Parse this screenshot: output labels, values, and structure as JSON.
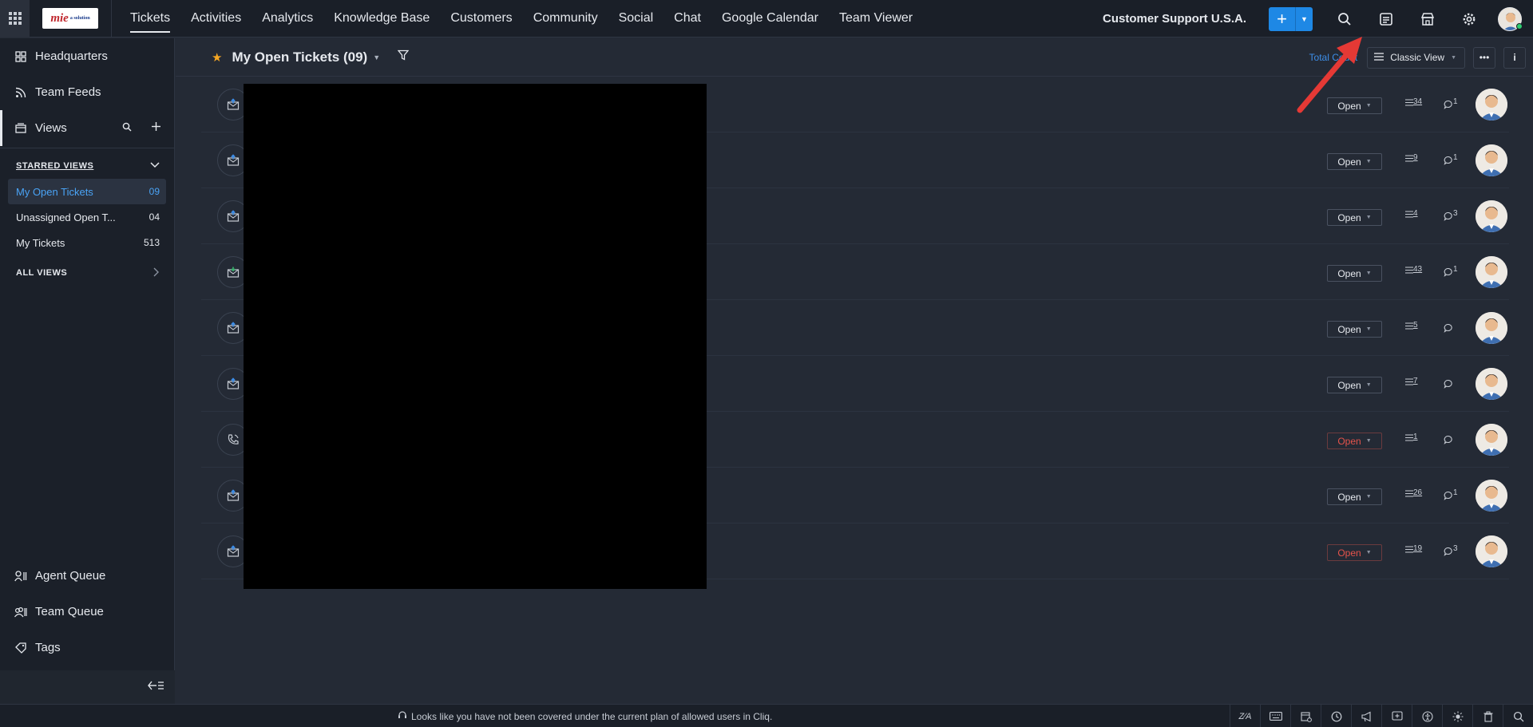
{
  "topbar": {
    "logo_text": "mie",
    "logo_sub": "a solution",
    "nav": [
      {
        "label": "Tickets",
        "active": true
      },
      {
        "label": "Activities"
      },
      {
        "label": "Analytics"
      },
      {
        "label": "Knowledge Base"
      },
      {
        "label": "Customers"
      },
      {
        "label": "Community"
      },
      {
        "label": "Social"
      },
      {
        "label": "Chat"
      },
      {
        "label": "Google Calendar"
      },
      {
        "label": "Team Viewer"
      }
    ],
    "org_name": "Customer Support U.S.A.",
    "add_label": "+",
    "icons": [
      "search-icon",
      "compose-ticket-icon",
      "marketplace-icon",
      "settings-icon"
    ]
  },
  "sidebar": {
    "items": [
      {
        "label": "Headquarters",
        "icon": "grid-icon"
      },
      {
        "label": "Team Feeds",
        "icon": "feed-icon"
      }
    ],
    "views_label": "Views",
    "starred_label": "STARRED VIEWS",
    "starred": [
      {
        "label": "My Open Tickets",
        "count": "09",
        "active": true
      },
      {
        "label": "Unassigned Open T...",
        "count": "04"
      },
      {
        "label": "My Tickets",
        "count": "513"
      }
    ],
    "all_views_label": "ALL VIEWS",
    "bottom": [
      {
        "label": "Agent Queue",
        "icon": "agent-queue-icon"
      },
      {
        "label": "Team Queue",
        "icon": "team-queue-icon"
      },
      {
        "label": "Tags",
        "icon": "tag-icon"
      }
    ]
  },
  "main": {
    "view_title": "My Open Tickets (09)",
    "total_count_label": "Total Count",
    "classic_view_label": "Classic View",
    "tickets": [
      {
        "channel": "email",
        "status": "Open",
        "status_color": "normal",
        "threads": "34",
        "comments": "1"
      },
      {
        "channel": "email",
        "status": "Open",
        "status_color": "normal",
        "threads": "9",
        "comments": "1"
      },
      {
        "channel": "email",
        "status": "Open",
        "status_color": "normal",
        "threads": "4",
        "comments": "3"
      },
      {
        "channel": "email-replied",
        "status": "Open",
        "status_color": "normal",
        "threads": "43",
        "comments": "1"
      },
      {
        "channel": "email",
        "status": "Open",
        "status_color": "normal",
        "threads": "5",
        "comments": ""
      },
      {
        "channel": "email",
        "status": "Open",
        "status_color": "normal",
        "threads": "7",
        "comments": ""
      },
      {
        "channel": "phone",
        "status": "Open",
        "status_color": "red",
        "threads": "1",
        "comments": ""
      },
      {
        "channel": "email",
        "status": "Open",
        "status_color": "normal",
        "threads": "26",
        "comments": "1"
      },
      {
        "channel": "email",
        "status": "Open",
        "status_color": "red",
        "threads": "19",
        "comments": "3"
      }
    ]
  },
  "statusbar": {
    "message": "Looks like you have not been covered under the current plan of allowed users in Cliq."
  },
  "colors": {
    "accent": "#1e88e5",
    "link": "#3d8ee8",
    "overdue": "#e5534b",
    "star": "#f5a623",
    "annotation_arrow": "#e53935"
  }
}
